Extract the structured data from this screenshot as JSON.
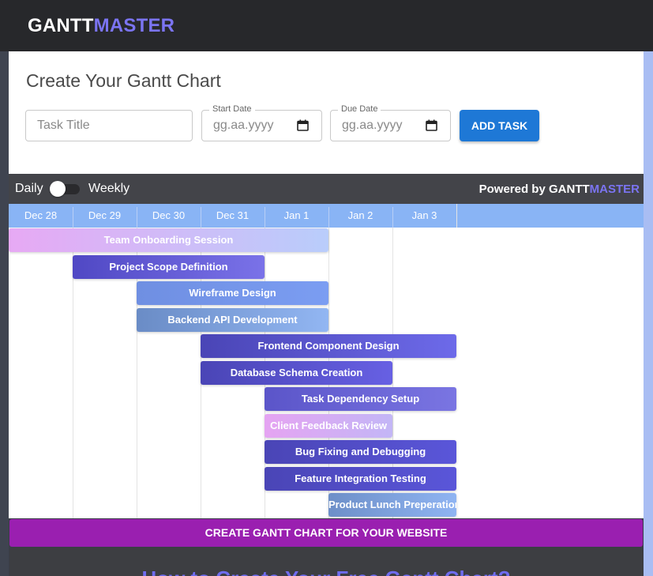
{
  "brand": {
    "part1": "GANTT",
    "part2": "MASTER"
  },
  "form": {
    "title": "Create Your Gantt Chart",
    "task_title_placeholder": "Task Title",
    "start_date_legend": "Start Date",
    "start_date_placeholder": "gg.aa.yyyy",
    "due_date_legend": "Due Date",
    "due_date_placeholder": "gg.aa.yyyy",
    "add_button": "ADD TASK"
  },
  "controls": {
    "daily_label": "Daily",
    "weekly_label": "Weekly",
    "toggle_state": "daily",
    "powered_prefix": "Powered by ",
    "powered_brand1": "GANTT",
    "powered_brand2": "MASTER"
  },
  "gantt": {
    "days": [
      "Dec 28",
      "Dec 29",
      "Dec 30",
      "Dec 31",
      "Jan 1",
      "Jan 2",
      "Jan 3"
    ],
    "tasks": [
      {
        "name": "Team Onboarding Session",
        "start": 0,
        "end": 5,
        "colors": [
          "#e7a9f4",
          "#b9cdfb"
        ]
      },
      {
        "name": "Project Scope Definition",
        "start": 1,
        "end": 4,
        "colors": [
          "#5048c4",
          "#7a72e8"
        ]
      },
      {
        "name": "Wireframe Design",
        "start": 2,
        "end": 5,
        "colors": [
          "#6f8fe2",
          "#7b9df2"
        ]
      },
      {
        "name": "Backend API Development",
        "start": 2,
        "end": 5,
        "colors": [
          "#6a8cc6",
          "#92b6f2"
        ]
      },
      {
        "name": "Frontend Component Design",
        "start": 3,
        "end": 7,
        "colors": [
          "#4a45b6",
          "#6d6ae9"
        ]
      },
      {
        "name": "Database Schema Creation",
        "start": 3,
        "end": 6,
        "colors": [
          "#4a45b6",
          "#6760e3"
        ]
      },
      {
        "name": "Task Dependency Setup",
        "start": 4,
        "end": 7,
        "colors": [
          "#5b55c9",
          "#7a75e2"
        ]
      },
      {
        "name": "Client Feedback Review",
        "start": 4,
        "end": 6,
        "colors": [
          "#e5a4f2",
          "#c3b6f6"
        ]
      },
      {
        "name": "Bug Fixing and Debugging",
        "start": 4,
        "end": 7,
        "colors": [
          "#4a45b6",
          "#5a56d9"
        ]
      },
      {
        "name": "Feature Integration Testing",
        "start": 4,
        "end": 7,
        "colors": [
          "#4a45b6",
          "#5a56d9"
        ]
      },
      {
        "name": "Product Lunch Preperation",
        "start": 5,
        "end": 7,
        "colors": [
          "#6d8fc8",
          "#8fb4f2"
        ]
      }
    ]
  },
  "cta": {
    "label": "CREATE GANTT CHART FOR YOUR WEBSITE"
  },
  "lower": {
    "title": "How to Create Your Free Gantt Chart?"
  }
}
